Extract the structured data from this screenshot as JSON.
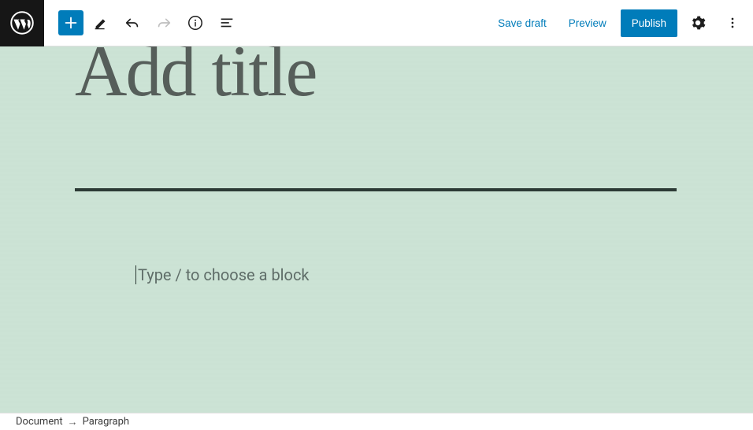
{
  "toolbar": {
    "save_draft": "Save draft",
    "preview": "Preview",
    "publish": "Publish"
  },
  "editor": {
    "title_placeholder": "Add title",
    "block_placeholder": "Type / to choose a block"
  },
  "breadcrumb": {
    "root": "Document",
    "current": "Paragraph"
  },
  "colors": {
    "accent": "#007cba",
    "canvas": "#cbe2d4"
  }
}
